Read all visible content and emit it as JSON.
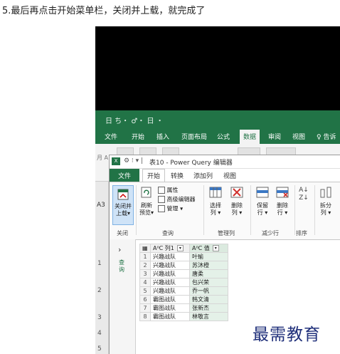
{
  "caption": "5.最后再点击开始菜单栏，关闭并上载，就完成了",
  "excel": {
    "quick_access": "日 ち・ ♂・ 日 ・",
    "tabs": [
      "文件",
      "开始",
      "插入",
      "页面布局",
      "公式",
      "数据",
      "审阅",
      "视图",
      "♀ 告诉"
    ],
    "active_tab": "数据",
    "name_box": "A3",
    "row_numbers": [
      "1",
      "2",
      "3",
      "4",
      "5"
    ],
    "partial_labels": [
      "月 A"
    ],
    "colors": {
      "brand": "#217346"
    }
  },
  "pq": {
    "title": "表10 - Power Query 编辑器",
    "tabs": {
      "file": "文件",
      "home": "开始",
      "transform": "转换",
      "add_column": "添加列",
      "view": "视图"
    },
    "ribbon": {
      "close_load": "关闭并\n上载▾",
      "refresh_preview": "刷新\n预览▾",
      "properties": "属性",
      "advanced_editor": "高级编辑器",
      "manage": "管理 ▾",
      "choose_columns": "选择\n列 ▾",
      "remove_columns": "删除\n列 ▾",
      "keep_rows": "保留\n行 ▾",
      "remove_rows": "删除\n行 ▾",
      "split_column": "拆分\n列 ▾",
      "groups": {
        "close": "关闭",
        "query": "查询",
        "manage_columns": "管理列",
        "reduce_rows": "减少行",
        "sort": "排序"
      }
    },
    "nav": {
      "chevron": "›",
      "label": "查询"
    },
    "table": {
      "headers": [
        "A⁰C 列1",
        "A⁰C 值"
      ],
      "rows": [
        [
          "1",
          "兴趣战队",
          "叶瑜"
        ],
        [
          "2",
          "兴趣战队",
          "苏沐橙"
        ],
        [
          "3",
          "兴趣战队",
          "唐柔"
        ],
        [
          "4",
          "兴趣战队",
          "包兴荣"
        ],
        [
          "5",
          "兴趣战队",
          "乔一帆"
        ],
        [
          "6",
          "霸图战队",
          "韩文清"
        ],
        [
          "7",
          "霸图战队",
          "张新杰"
        ],
        [
          "8",
          "霸图战队",
          "林敬言"
        ]
      ]
    }
  },
  "watermark": "最需教育"
}
